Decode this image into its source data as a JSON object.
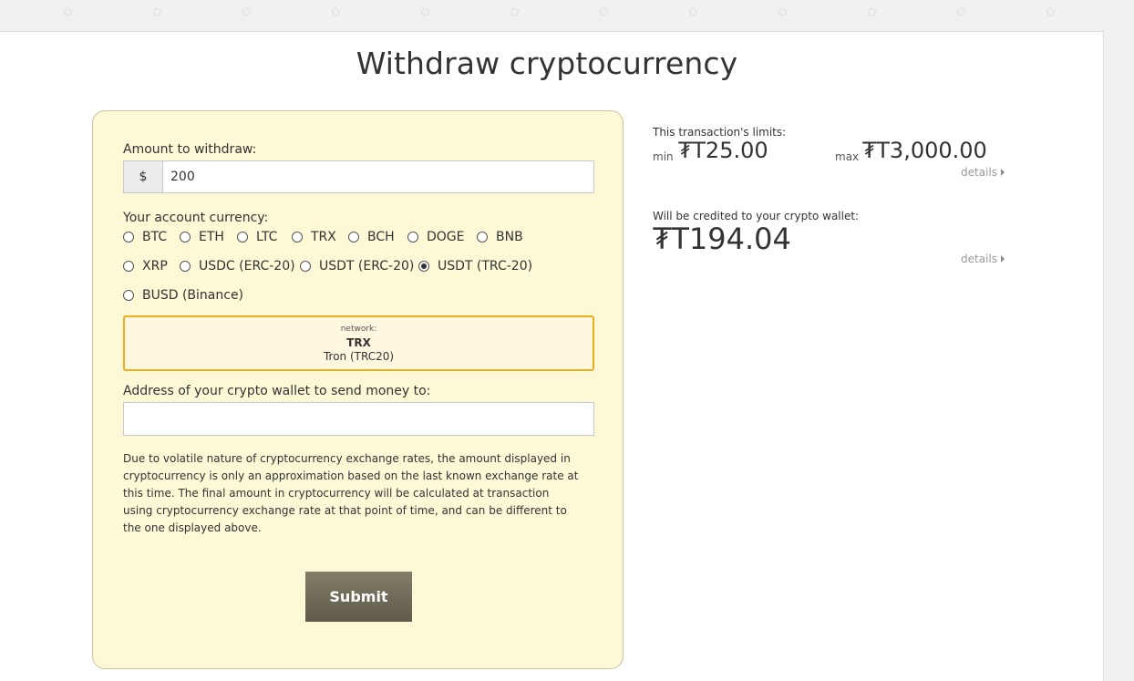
{
  "title": "Withdraw cryptocurrency",
  "form": {
    "amount_label": "Amount to withdraw:",
    "amount_prefix": "$",
    "amount_value": "200",
    "currency_label": "Your account currency:",
    "currencies": [
      "BTC",
      "ETH",
      "LTC",
      "TRX",
      "BCH",
      "DOGE",
      "BNB",
      "XRP",
      "USDC (ERC-20)",
      "USDT (ERC-20)",
      "USDT (TRC-20)",
      "BUSD (Binance)"
    ],
    "selected_currency": "USDT (TRC-20)",
    "network": {
      "caption": "network:",
      "code": "TRX",
      "name": "Tron (TRC20)"
    },
    "wallet_label": "Address of your crypto wallet to send money to:",
    "wallet_value": "",
    "disclaimer": "Due to volatile nature of cryptocurrency exchange rates, the amount displayed in cryptocurrency is only an approximation based on the last known exchange rate at this time. The final amount in cryptocurrency will be calculated at transaction using cryptocurrency exchange rate at that point of time, and can be different to the one displayed above.",
    "submit_label": "Submit"
  },
  "limits": {
    "label": "This transaction's limits:",
    "min_label": "min",
    "min_value": "₮T25.00",
    "max_label": "max",
    "max_value": "₮T3,000.00",
    "details_label": "details"
  },
  "credit": {
    "label": "Will be credited to your crypto wallet:",
    "value": "₮T194.04",
    "details_label": "details"
  },
  "icons": {
    "background_pattern": "star-outline-icon",
    "details_arrow": "caret-right-icon"
  },
  "colors": {
    "form_background": "#fdf8d6",
    "network_border": "#f0ad1e",
    "submit_background": "#6e6958"
  }
}
